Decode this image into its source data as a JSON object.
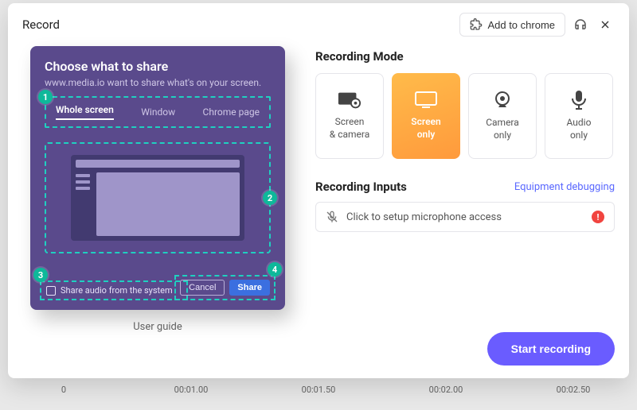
{
  "modal": {
    "title": "Record",
    "add_to_chrome": "Add to chrome"
  },
  "share_card": {
    "title": "Choose what to share",
    "subtitle": "www.media.io want to share what's on your screen.",
    "tabs": {
      "whole": "Whole screen",
      "window": "Window",
      "chrome": "Chrome page"
    },
    "share_audio_label": "Share audio from the system",
    "cancel": "Cancel",
    "share": "Share",
    "user_guide": "User guide",
    "markers": {
      "one": "1",
      "two": "2",
      "three": "3",
      "four": "4"
    }
  },
  "recording_mode": {
    "heading": "Recording Mode",
    "options": [
      {
        "id": "screen-camera",
        "line1": "Screen",
        "line2": "& camera"
      },
      {
        "id": "screen-only",
        "line1": "Screen",
        "line2": "only"
      },
      {
        "id": "camera-only",
        "line1": "Camera",
        "line2": "only"
      },
      {
        "id": "audio-only",
        "line1": "Audio",
        "line2": "only"
      }
    ]
  },
  "recording_inputs": {
    "heading": "Recording Inputs",
    "equip_link": "Equipment debugging",
    "mic_text": "Click to setup microphone access"
  },
  "start_button": "Start recording",
  "timeline": [
    "0",
    "00:01.00",
    "00:01.50",
    "00:02.00",
    "00:02.50"
  ]
}
